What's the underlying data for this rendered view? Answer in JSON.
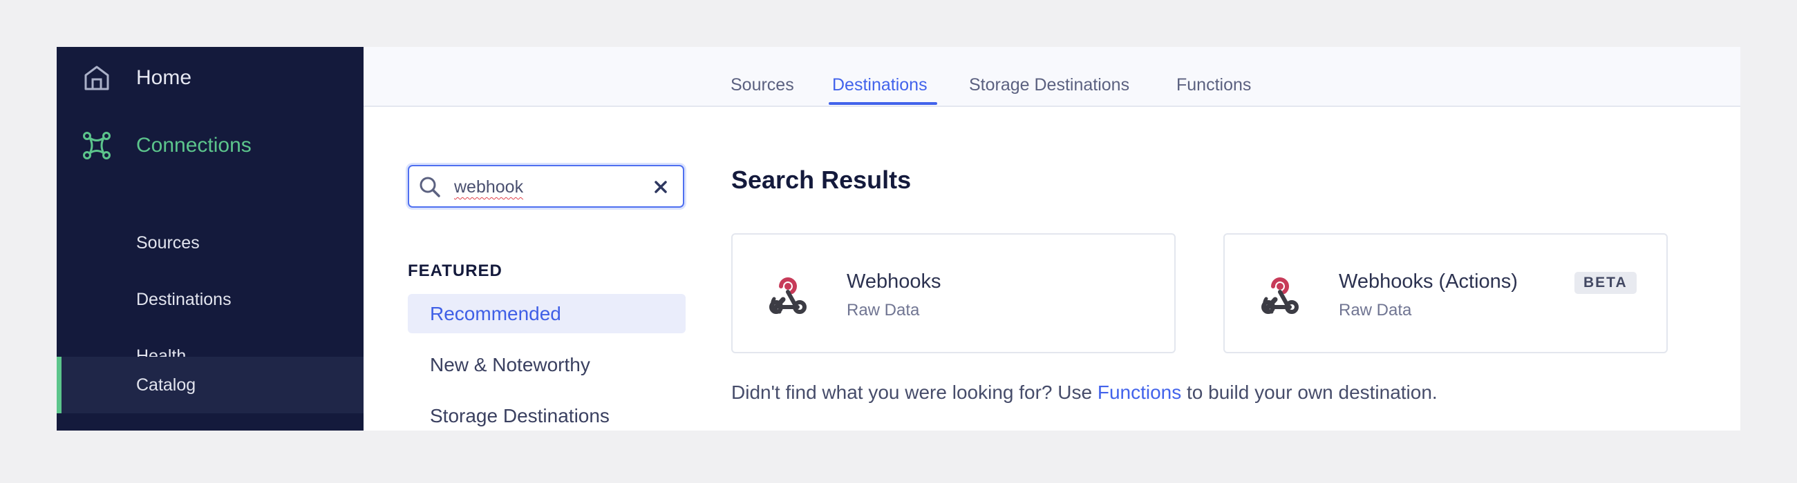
{
  "sidebar": {
    "home_label": "Home",
    "connections_label": "Connections",
    "items": [
      {
        "label": "Sources"
      },
      {
        "label": "Destinations"
      },
      {
        "label": "Health"
      },
      {
        "label": "Catalog"
      }
    ],
    "active_item": "Catalog",
    "accent_color": "#5cc58c",
    "background_color": "#141a3c"
  },
  "tabs": [
    {
      "label": "Sources"
    },
    {
      "label": "Destinations"
    },
    {
      "label": "Storage Destinations"
    },
    {
      "label": "Functions"
    }
  ],
  "active_tab": "Destinations",
  "accent_color": "#4263eb",
  "search": {
    "value": "webhook",
    "icon": "search-icon",
    "clear_icon": "close-icon"
  },
  "categories": {
    "heading": "FEATURED",
    "items": [
      {
        "label": "Recommended"
      },
      {
        "label": "New & Noteworthy"
      },
      {
        "label": "Storage Destinations"
      }
    ],
    "selected": "Recommended"
  },
  "results": {
    "title": "Search Results",
    "cards": [
      {
        "name": "Webhooks",
        "subtitle": "Raw Data",
        "icon": "webhook-icon"
      },
      {
        "name": "Webhooks (Actions)",
        "subtitle": "Raw Data",
        "badge": "BETA",
        "icon": "webhook-icon"
      }
    ]
  },
  "footnote": {
    "before": "Didn't find what you were looking for? Use ",
    "link": "Functions",
    "after": " to build your own destination."
  }
}
